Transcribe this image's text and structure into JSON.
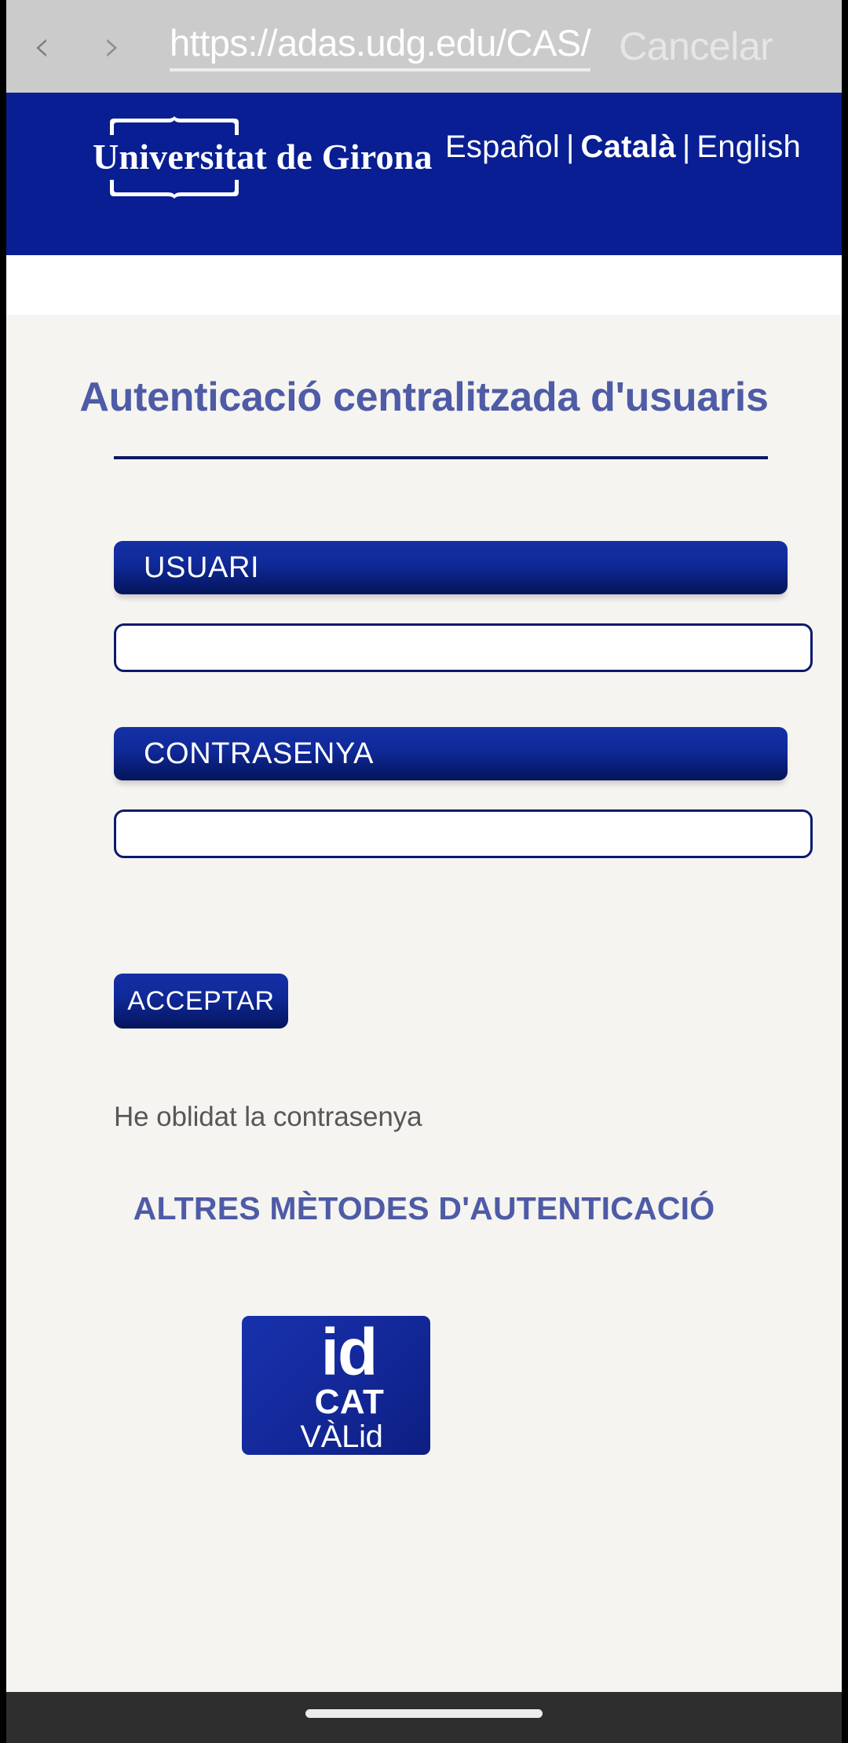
{
  "browser": {
    "back_icon": "chevron-left-icon",
    "forward_icon": "chevron-right-icon",
    "url": "https://adas.udg.edu/CAS/",
    "cancel_label": "Cancelar"
  },
  "header": {
    "logo_text": "Universitat de Girona",
    "languages": [
      {
        "label": "Español",
        "active": false
      },
      {
        "label": "Català",
        "active": true
      },
      {
        "label": "English",
        "active": false
      }
    ],
    "separator": "|"
  },
  "main": {
    "title": "Autenticació centralitzada d'usuaris",
    "username_label": "USUARI",
    "username_value": "",
    "password_label": "CONTRASENYA",
    "password_value": "",
    "submit_label": "ACCEPTAR",
    "forgot_label": "He oblidat la contrasenya",
    "alt_methods_heading": "ALTRES MÈTODES D'AUTENTICACIÓ",
    "idcat": {
      "line1": "id",
      "line2": "CAT",
      "line3": "VÀLid"
    }
  },
  "system": {
    "home_indicator": "home-indicator"
  },
  "colors": {
    "header_navy": "#081e92",
    "accent_navy": "#0b1a6b",
    "title_blue": "#4e5ba6",
    "page_bg": "#f5f4f0",
    "chrome_gray": "#cbcbcb",
    "system_bar": "#2e2e2e"
  }
}
